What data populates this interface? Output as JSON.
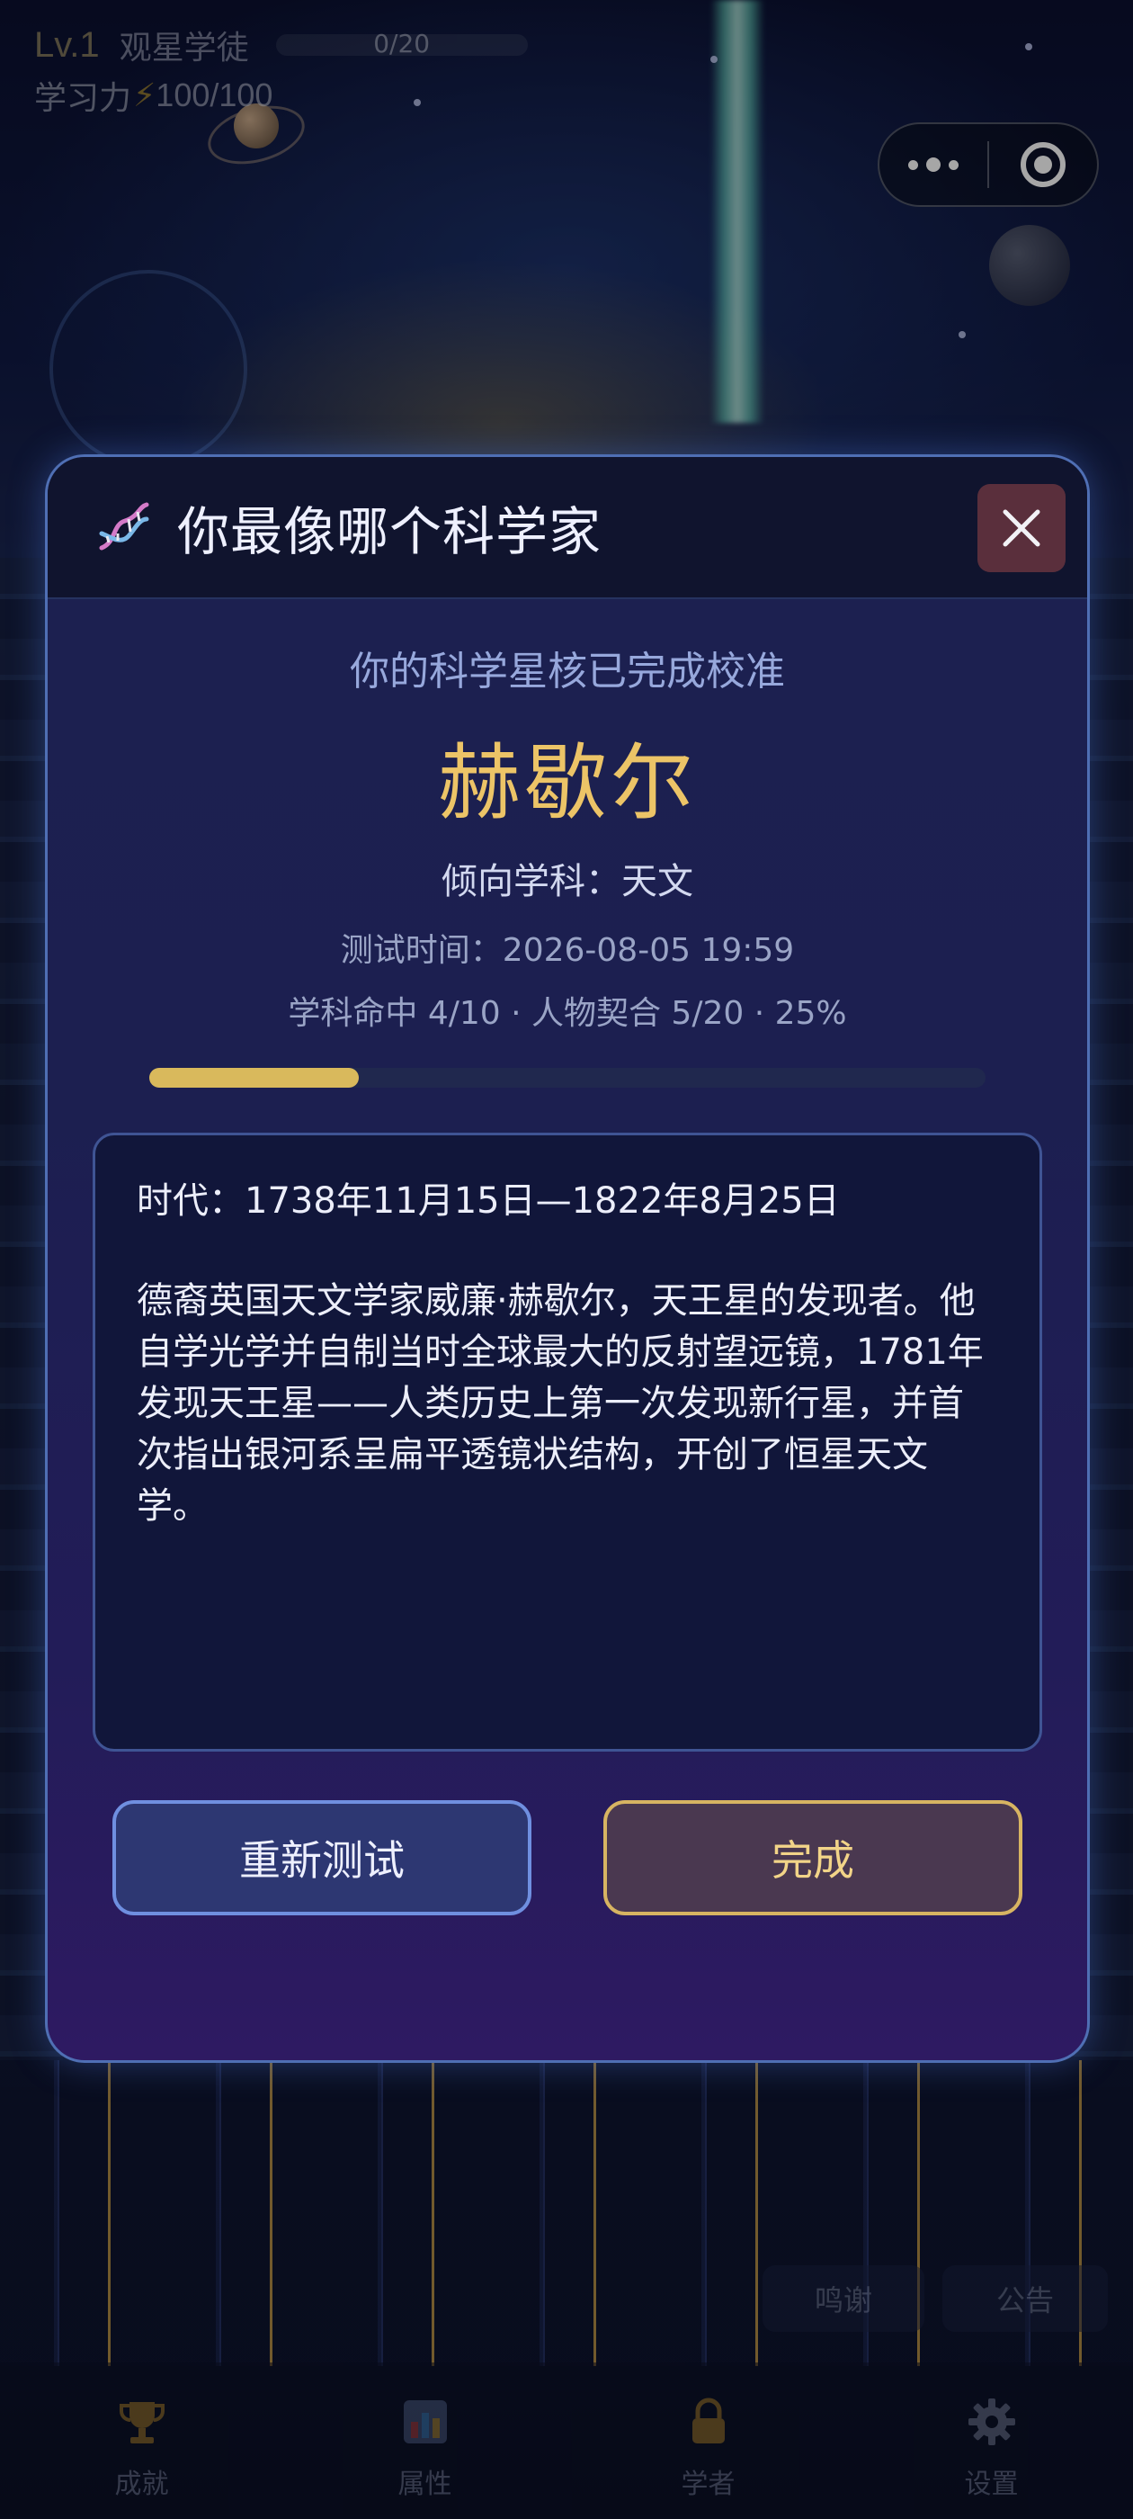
{
  "hud": {
    "level": "Lv.1",
    "rank": "观星学徒",
    "xp_text": "0/20",
    "energy_label": "学习力",
    "energy_value": "100/100"
  },
  "modal": {
    "title": "你最像哪个科学家",
    "subtitle": "你的科学星核已完成校准",
    "scientist_name": "赫歇尔",
    "discipline": "倾向学科：天文",
    "test_time": "测试时间：2026-08-05 19:59",
    "stats": "学科命中 4/10 · 人物契合 5/20 · 25%",
    "match_percent": 25,
    "era": "时代：1738年11月15日—1822年8月25日",
    "description": "德裔英国天文学家威廉·赫歇尔，天王星的发现者。他自学光学并自制当时全球最大的反射望远镜，1781年发现天王星——人类历史上第一次发现新行星，并首次指出银河系呈扁平透镜状结构，开创了恒星天文学。",
    "retry_label": "重新测试",
    "done_label": "完成"
  },
  "shortcuts": {
    "thanks": "鸣谢",
    "notice": "公告"
  },
  "tabs": [
    {
      "label": "成就",
      "icon": "trophy-icon"
    },
    {
      "label": "属性",
      "icon": "bar-chart-icon"
    },
    {
      "label": "学者",
      "icon": "lock-icon"
    },
    {
      "label": "设置",
      "icon": "gear-icon"
    }
  ],
  "colors": {
    "accent_gold": "#ecc467",
    "modal_border": "#4f6fb4",
    "retry_border": "#6f8fe0",
    "done_border": "#d7b462",
    "close_bg": "#5a2f3c"
  }
}
